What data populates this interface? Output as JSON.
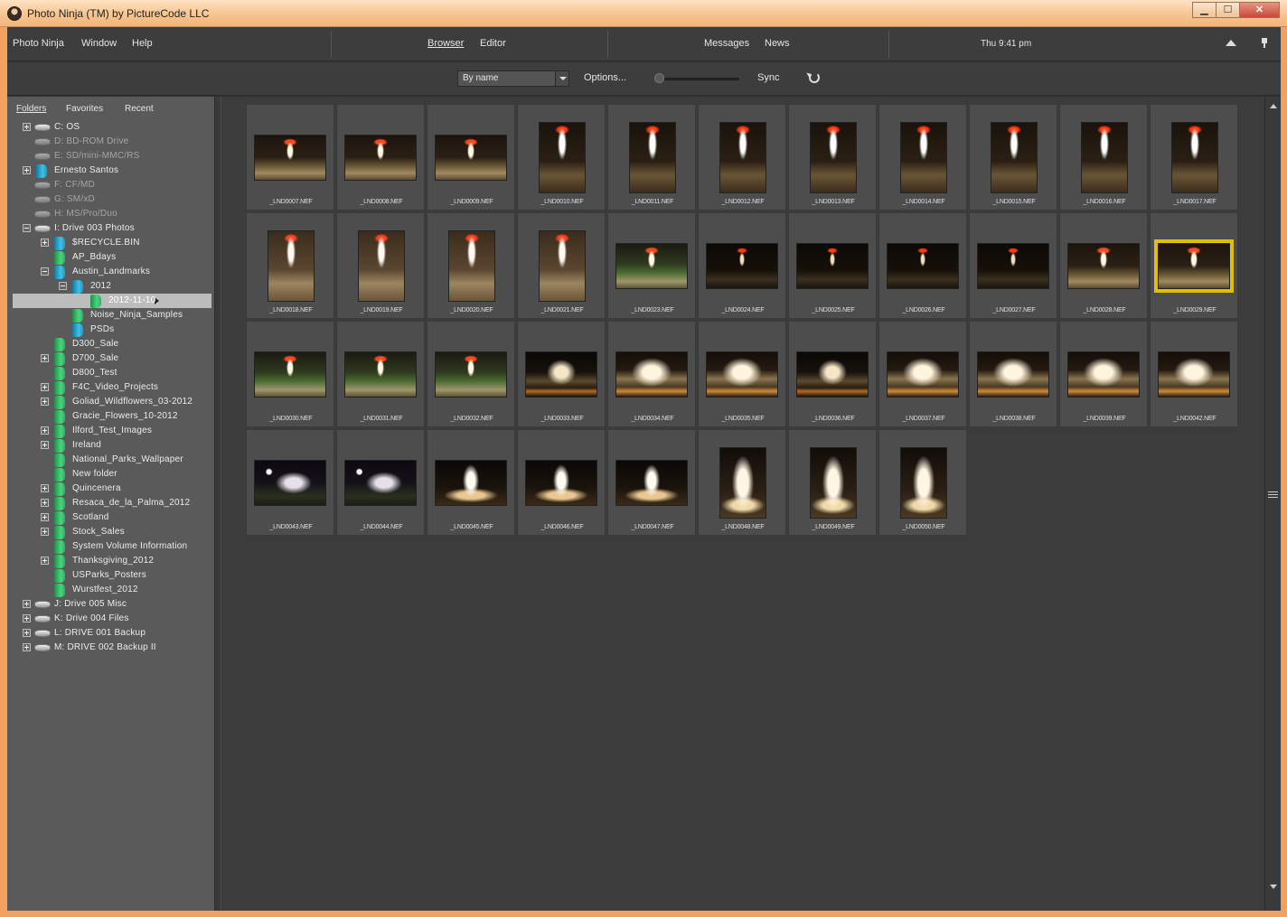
{
  "window": {
    "title": "Photo Ninja (TM) by PictureCode LLC",
    "buttons": {
      "minimize": "▁",
      "maximize": "☐",
      "close": "✕"
    }
  },
  "menubar": {
    "app_menu": "Photo Ninja",
    "window_menu": "Window",
    "help_menu": "Help",
    "browser_tab": "Browser",
    "editor_tab": "Editor",
    "messages": "Messages",
    "news": "News",
    "clock": "Thu 9:41 pm"
  },
  "toolbar": {
    "sort_value": "By name",
    "options_label": "Options...",
    "thumbnail_size_fraction": 0.0,
    "sync_label": "Sync"
  },
  "left_panel": {
    "tabs": {
      "folders": "Folders",
      "favorites": "Favorites",
      "recent": "Recent"
    },
    "tree": [
      {
        "label": "C:  OS",
        "icon": "drive-icon",
        "expander": "plus",
        "indent": 0
      },
      {
        "label": "D:  BD-ROM Drive",
        "icon": "drive-icon",
        "expander": "none",
        "indent": 0,
        "dim": true
      },
      {
        "label": "E:  SD/mini-MMC/RS",
        "icon": "drive-icon",
        "expander": "none",
        "indent": 0,
        "dim": true
      },
      {
        "label": "Ernesto Santos",
        "icon": "folder-icon-cyan",
        "expander": "plus",
        "indent": 0
      },
      {
        "label": "F:  CF/MD",
        "icon": "drive-icon",
        "expander": "none",
        "indent": 0,
        "dim": true
      },
      {
        "label": "G:  SM/xD",
        "icon": "drive-icon",
        "expander": "none",
        "indent": 0,
        "dim": true
      },
      {
        "label": "H:  MS/Pro/Duo",
        "icon": "drive-icon",
        "expander": "none",
        "indent": 0,
        "dim": true
      },
      {
        "label": "I:  Drive 003 Photos",
        "icon": "drive-icon",
        "expander": "minus",
        "indent": 0
      },
      {
        "label": "$RECYCLE.BIN",
        "icon": "folder-icon-cyan",
        "expander": "plus",
        "indent": 1
      },
      {
        "label": "AP_Bdays",
        "icon": "folder-icon-green",
        "expander": "none",
        "indent": 1
      },
      {
        "label": "Austin_Landmarks",
        "icon": "folder-icon-cyan",
        "expander": "minus",
        "indent": 1
      },
      {
        "label": "2012",
        "icon": "folder-icon-cyan",
        "expander": "minus",
        "indent": 2
      },
      {
        "label": "2012-11-10",
        "icon": "folder-icon-green",
        "expander": "none",
        "indent": 3,
        "selected": true
      },
      {
        "label": "Noise_Ninja_Samples",
        "icon": "folder-icon-green",
        "expander": "none",
        "indent": 2
      },
      {
        "label": "PSDs",
        "icon": "folder-icon-cyan",
        "expander": "none",
        "indent": 2
      },
      {
        "label": "D300_Sale",
        "icon": "folder-icon-green",
        "expander": "none",
        "indent": 1
      },
      {
        "label": "D700_Sale",
        "icon": "folder-icon-green",
        "expander": "plus",
        "indent": 1
      },
      {
        "label": "D800_Test",
        "icon": "folder-icon-green",
        "expander": "none",
        "indent": 1
      },
      {
        "label": "F4C_Video_Projects",
        "icon": "folder-icon-green",
        "expander": "plus",
        "indent": 1
      },
      {
        "label": "Goliad_Wildflowers_03-2012",
        "icon": "folder-icon-green",
        "expander": "plus",
        "indent": 1
      },
      {
        "label": "Gracie_Flowers_10-2012",
        "icon": "folder-icon-green",
        "expander": "none",
        "indent": 1
      },
      {
        "label": "Ilford_Test_Images",
        "icon": "folder-icon-green",
        "expander": "plus",
        "indent": 1
      },
      {
        "label": "Ireland",
        "icon": "folder-icon-green",
        "expander": "plus",
        "indent": 1
      },
      {
        "label": "National_Parks_Wallpaper",
        "icon": "folder-icon-green",
        "expander": "none",
        "indent": 1
      },
      {
        "label": "New folder",
        "icon": "folder-icon-green",
        "expander": "none",
        "indent": 1
      },
      {
        "label": "Quincenera",
        "icon": "folder-icon-green",
        "expander": "plus",
        "indent": 1
      },
      {
        "label": "Resaca_de_la_Palma_2012",
        "icon": "folder-icon-green",
        "expander": "plus",
        "indent": 1
      },
      {
        "label": "Scotland",
        "icon": "folder-icon-green",
        "expander": "plus",
        "indent": 1
      },
      {
        "label": "Stock_Sales",
        "icon": "folder-icon-green",
        "expander": "plus",
        "indent": 1
      },
      {
        "label": "System Volume Information",
        "icon": "folder-icon-green",
        "expander": "none",
        "indent": 1
      },
      {
        "label": "Thanksgiving_2012",
        "icon": "folder-icon-green",
        "expander": "plus",
        "indent": 1
      },
      {
        "label": "USParks_Posters",
        "icon": "folder-icon-green",
        "expander": "none",
        "indent": 1
      },
      {
        "label": "Wurstfest_2012",
        "icon": "folder-icon-green",
        "expander": "none",
        "indent": 1
      },
      {
        "label": "J:  Drive 005 Misc",
        "icon": "drive-icon",
        "expander": "plus",
        "indent": 0
      },
      {
        "label": "K:  Drive 004 Files",
        "icon": "drive-icon",
        "expander": "plus",
        "indent": 0
      },
      {
        "label": "L:  DRIVE 001 Backup",
        "icon": "drive-icon",
        "expander": "plus",
        "indent": 0
      },
      {
        "label": "M:  DRIVE 002 Backup II",
        "icon": "drive-icon",
        "expander": "plus",
        "indent": 0
      }
    ]
  },
  "thumbnails": [
    {
      "name": "_LND0007.NEF",
      "kind": "tower-land",
      "orient": "land"
    },
    {
      "name": "_LND0008.NEF",
      "kind": "tower-land",
      "orient": "land"
    },
    {
      "name": "_LND0009.NEF",
      "kind": "tower-land",
      "orient": "land"
    },
    {
      "name": "_LND0010.NEF",
      "kind": "tower-port",
      "orient": "port"
    },
    {
      "name": "_LND0011.NEF",
      "kind": "tower-port",
      "orient": "port"
    },
    {
      "name": "_LND0012.NEF",
      "kind": "tower-port",
      "orient": "port"
    },
    {
      "name": "_LND0013.NEF",
      "kind": "tower-port",
      "orient": "port"
    },
    {
      "name": "_LND0014.NEF",
      "kind": "tower-port",
      "orient": "port"
    },
    {
      "name": "_LND0015.NEF",
      "kind": "tower-port",
      "orient": "port"
    },
    {
      "name": "_LND0016.NEF",
      "kind": "tower-port",
      "orient": "port"
    },
    {
      "name": "_LND0017.NEF",
      "kind": "tower-port",
      "orient": "port"
    },
    {
      "name": "_LND0018.NEF",
      "kind": "tower-port-light",
      "orient": "port"
    },
    {
      "name": "_LND0019.NEF",
      "kind": "tower-port-light",
      "orient": "port"
    },
    {
      "name": "_LND0020.NEF",
      "kind": "tower-port-light",
      "orient": "port"
    },
    {
      "name": "_LND0021.NEF",
      "kind": "tower-port-light",
      "orient": "port"
    },
    {
      "name": "_LND0023.NEF",
      "kind": "tower-green",
      "orient": "land"
    },
    {
      "name": "_LND0024.NEF",
      "kind": "tower-dark",
      "orient": "land"
    },
    {
      "name": "_LND0025.NEF",
      "kind": "tower-dark",
      "orient": "land"
    },
    {
      "name": "_LND0026.NEF",
      "kind": "tower-dark",
      "orient": "land"
    },
    {
      "name": "_LND0027.NEF",
      "kind": "tower-dark",
      "orient": "land"
    },
    {
      "name": "_LND0028.NEF",
      "kind": "tower-land",
      "orient": "land"
    },
    {
      "name": "_LND0029.NEF",
      "kind": "tower-land",
      "orient": "land",
      "selected": true
    },
    {
      "name": "_LND0030.NEF",
      "kind": "tower-green",
      "orient": "land"
    },
    {
      "name": "_LND0031.NEF",
      "kind": "tower-green",
      "orient": "land"
    },
    {
      "name": "_LND0032.NEF",
      "kind": "tower-green",
      "orient": "land"
    },
    {
      "name": "_LND0033.NEF",
      "kind": "capitol-dark",
      "orient": "land"
    },
    {
      "name": "_LND0034.NEF",
      "kind": "capitol-warm",
      "orient": "land"
    },
    {
      "name": "_LND0035.NEF",
      "kind": "capitol-warm",
      "orient": "land"
    },
    {
      "name": "_LND0036.NEF",
      "kind": "capitol-dark",
      "orient": "land"
    },
    {
      "name": "_LND0037.NEF",
      "kind": "capitol-warm",
      "orient": "land"
    },
    {
      "name": "_LND0038.NEF",
      "kind": "capitol-warm",
      "orient": "land"
    },
    {
      "name": "_LND0039.NEF",
      "kind": "capitol-warm",
      "orient": "land"
    },
    {
      "name": "_LND0042.NEF",
      "kind": "capitol-warm",
      "orient": "land"
    },
    {
      "name": "_LND0043.NEF",
      "kind": "capitol-night",
      "orient": "land"
    },
    {
      "name": "_LND0044.NEF",
      "kind": "capitol-night",
      "orient": "land"
    },
    {
      "name": "_LND0045.NEF",
      "kind": "capitol-dome",
      "orient": "land"
    },
    {
      "name": "_LND0046.NEF",
      "kind": "capitol-dome",
      "orient": "land"
    },
    {
      "name": "_LND0047.NEF",
      "kind": "capitol-dome",
      "orient": "land"
    },
    {
      "name": "_LND0048.NEF",
      "kind": "capitol-port",
      "orient": "port"
    },
    {
      "name": "_LND0049.NEF",
      "kind": "capitol-port",
      "orient": "port"
    },
    {
      "name": "_LND0050.NEF",
      "kind": "capitol-port",
      "orient": "port"
    }
  ]
}
